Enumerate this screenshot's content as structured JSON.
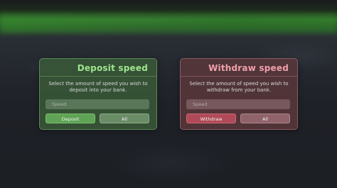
{
  "deposit_panel": {
    "title": "Deposit speed",
    "description": "Select the amount of speed you wish to deposit into your bank.",
    "input_placeholder": "Speed",
    "primary_button": "Deposit",
    "all_button": "All",
    "accent_color": "#9ee58f"
  },
  "withdraw_panel": {
    "title": "Withdraw speed",
    "description": "Select the amount of speed you wish to withdraw from your bank.",
    "input_placeholder": "Speed",
    "primary_button": "Withdraw",
    "all_button": "All",
    "accent_color": "#f0a0ac"
  }
}
